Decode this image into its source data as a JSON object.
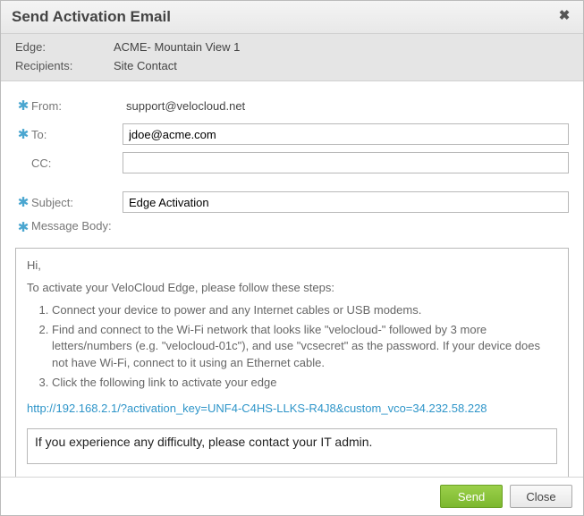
{
  "dialog": {
    "title": "Send Activation Email",
    "close_glyph": "✖"
  },
  "meta": {
    "edge_label": "Edge:",
    "edge_value": "ACME- Mountain View 1",
    "recipients_label": "Recipients:",
    "recipients_value": "Site Contact"
  },
  "form": {
    "req_glyph": "✱",
    "from_label": "From:",
    "from_value": "support@velocloud.net",
    "to_label": "To:",
    "to_value": "jdoe@acme.com",
    "cc_label": "CC:",
    "cc_value": "",
    "subject_label": "Subject:",
    "subject_value": "Edge Activation",
    "message_body_label": "Message Body:"
  },
  "message": {
    "greeting": "Hi,",
    "intro": "To activate your VeloCloud Edge, please follow these steps:",
    "step1": "Connect your device to power and any Internet cables or USB modems.",
    "step2": "Find and connect to the Wi-Fi network that looks like \"velocloud-\" followed by 3 more letters/numbers (e.g. \"velocloud-01c\"), and use \"vcsecret\" as the password. If your device does not have Wi-Fi, connect to it using an Ethernet cable.",
    "step3": "Click the following link to activate your edge",
    "activation_url": "http://192.168.2.1/?activation_key=UNF4-C4HS-LLKS-R4J8&custom_vco=34.232.58.228",
    "footer_text": "If you experience any difficulty, please contact your IT admin."
  },
  "buttons": {
    "send": "Send",
    "close": "Close"
  }
}
